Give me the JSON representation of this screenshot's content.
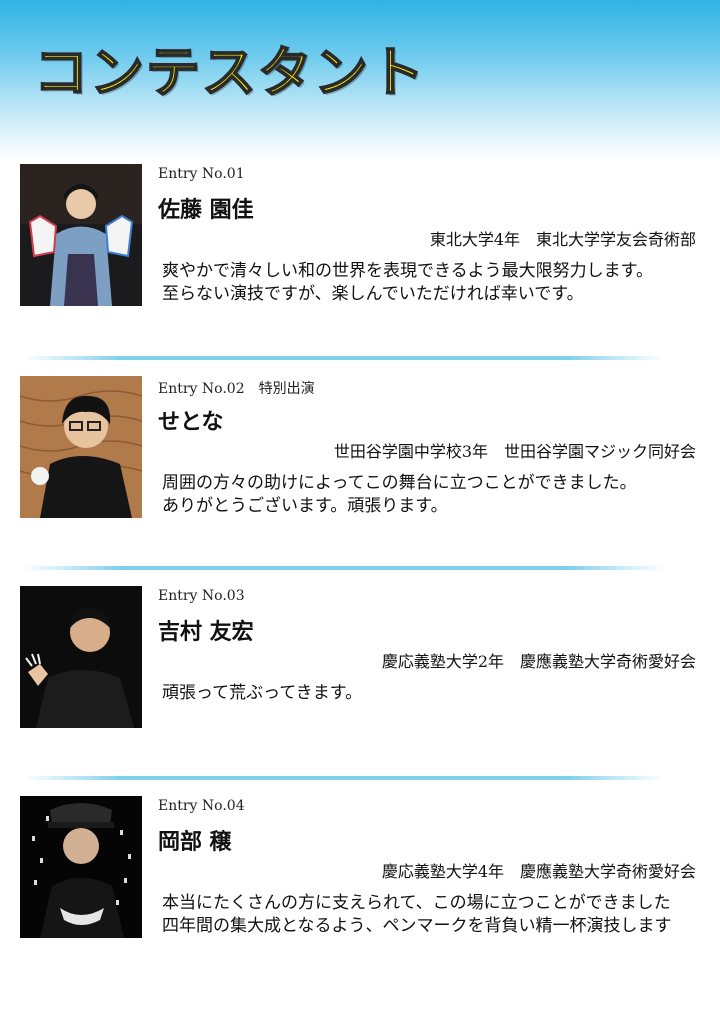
{
  "header": {
    "title": "コンテスタント"
  },
  "entries": [
    {
      "entry_no": "Entry No.01",
      "special": "",
      "name": "佐藤 園佳",
      "affiliation": "東北大学4年　東北大学学友会奇術部",
      "message": [
        "爽やかで清々しい和の世界を表現できるよう最大限努力します。",
        "至らない演技ですが、楽しんでいただければ幸いです。"
      ]
    },
    {
      "entry_no": "Entry No.02",
      "special": "特別出演",
      "name": "せとな",
      "affiliation": "世田谷学園中学校3年　世田谷学園マジック同好会",
      "message": [
        "周囲の方々の助けによってこの舞台に立つことができました。",
        "ありがとうございます。頑張ります。"
      ]
    },
    {
      "entry_no": "Entry No.03",
      "special": "",
      "name": "吉村 友宏",
      "affiliation": "慶応義塾大学2年　慶應義塾大学奇術愛好会",
      "message": [
        "頑張って荒ぶってきます。"
      ]
    },
    {
      "entry_no": "Entry No.04",
      "special": "",
      "name": "岡部 穣",
      "affiliation": "慶応義塾大学4年　慶應義塾大学奇術愛好会",
      "message": [
        "本当にたくさんの方に支えられて、この場に立つことができました",
        "四年間の集大成となるよう、ペンマークを背負い精一杯演技します"
      ]
    }
  ]
}
